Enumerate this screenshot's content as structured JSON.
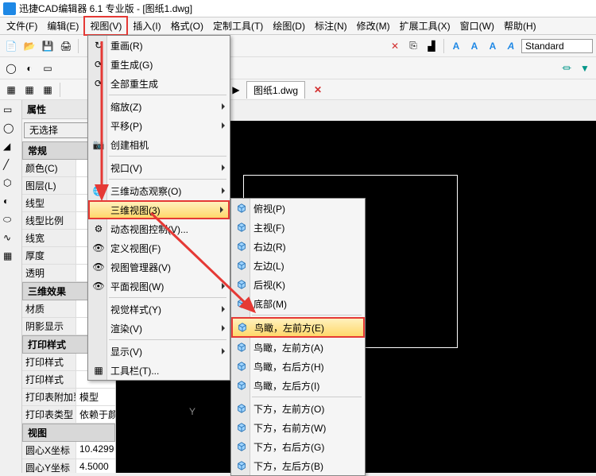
{
  "title": "迅捷CAD编辑器 6.1 专业版  - [图纸1.dwg]",
  "menubar": [
    "文件(F)",
    "编辑(E)",
    "视图(V)",
    "插入(I)",
    "格式(O)",
    "定制工具(T)",
    "绘图(D)",
    "标注(N)",
    "修改(M)",
    "扩展工具(X)",
    "窗口(W)",
    "帮助(H)"
  ],
  "text_style": "Standard",
  "file_tab": {
    "label": "图纸1.dwg"
  },
  "properties": {
    "title": "属性",
    "selector": "无选择",
    "sections": {
      "general": {
        "header": "常规",
        "rows": [
          {
            "k": "颜色(C)",
            "v": ""
          },
          {
            "k": "图层(L)",
            "v": ""
          },
          {
            "k": "线型",
            "v": ""
          },
          {
            "k": "线型比例",
            "v": ""
          },
          {
            "k": "线宽",
            "v": ""
          },
          {
            "k": "厚度",
            "v": ""
          },
          {
            "k": "透明",
            "v": ""
          }
        ]
      },
      "threeD": {
        "header": "三维效果",
        "rows": [
          {
            "k": "材质",
            "v": ""
          },
          {
            "k": "阴影显示",
            "v": ""
          }
        ]
      },
      "print": {
        "header": "打印样式",
        "rows": [
          {
            "k": "打印样式",
            "v": ""
          },
          {
            "k": "打印样式",
            "v": ""
          },
          {
            "k": "打印表附加到",
            "v": "模型"
          },
          {
            "k": "打印表类型",
            "v": "依赖于颜..."
          }
        ]
      },
      "view": {
        "header": "视图",
        "rows": [
          {
            "k": "圆心X坐标",
            "v": "10.4299"
          },
          {
            "k": "圆心Y坐标",
            "v": "4.5000"
          }
        ]
      }
    }
  },
  "view_menu": {
    "items": [
      {
        "label": "重画(R)",
        "icon": "redraw"
      },
      {
        "label": "重生成(G)",
        "icon": "regen"
      },
      {
        "label": "全部重生成",
        "icon": "regen-all"
      },
      {
        "sep": true
      },
      {
        "label": "缩放(Z)",
        "sub": true
      },
      {
        "label": "平移(P)",
        "sub": true
      },
      {
        "label": "创建相机",
        "icon": "camera"
      },
      {
        "sep": true
      },
      {
        "label": "视口(V)",
        "sub": true
      },
      {
        "sep": true
      },
      {
        "label": "三维动态观察(O)",
        "icon": "orbit",
        "sub": true
      },
      {
        "label": "三维视图(3)",
        "sub": true,
        "hl": true
      },
      {
        "label": "动态视图控制(V)...",
        "icon": "dyn"
      },
      {
        "label": "定义视图(F)",
        "icon": "eye"
      },
      {
        "label": "视图管理器(V)",
        "icon": "eye"
      },
      {
        "label": "平面视图(W)",
        "icon": "eye",
        "sub": true
      },
      {
        "sep": true
      },
      {
        "label": "视觉样式(Y)",
        "sub": true
      },
      {
        "label": "渲染(V)",
        "sub": true
      },
      {
        "sep": true
      },
      {
        "label": "显示(V)",
        "sub": true
      },
      {
        "label": "工具栏(T)...",
        "icon": "toolbar"
      }
    ]
  },
  "sub_menu": {
    "items": [
      {
        "label": "俯视(P)"
      },
      {
        "label": "主视(F)"
      },
      {
        "label": "右边(R)"
      },
      {
        "label": "左边(L)"
      },
      {
        "label": "后视(K)"
      },
      {
        "label": "底部(M)"
      },
      {
        "sep": true
      },
      {
        "label": "鸟瞰，左前方(E)",
        "hl": true
      },
      {
        "label": "鸟瞰，左前方(A)"
      },
      {
        "label": "鸟瞰，右后方(H)"
      },
      {
        "label": "鸟瞰，左后方(I)"
      },
      {
        "sep": true
      },
      {
        "label": "下方，左前方(O)"
      },
      {
        "label": "下方，右前方(W)"
      },
      {
        "label": "下方，右后方(G)"
      },
      {
        "label": "下方，左后方(B)"
      }
    ]
  },
  "axis": {
    "y": "Y"
  }
}
